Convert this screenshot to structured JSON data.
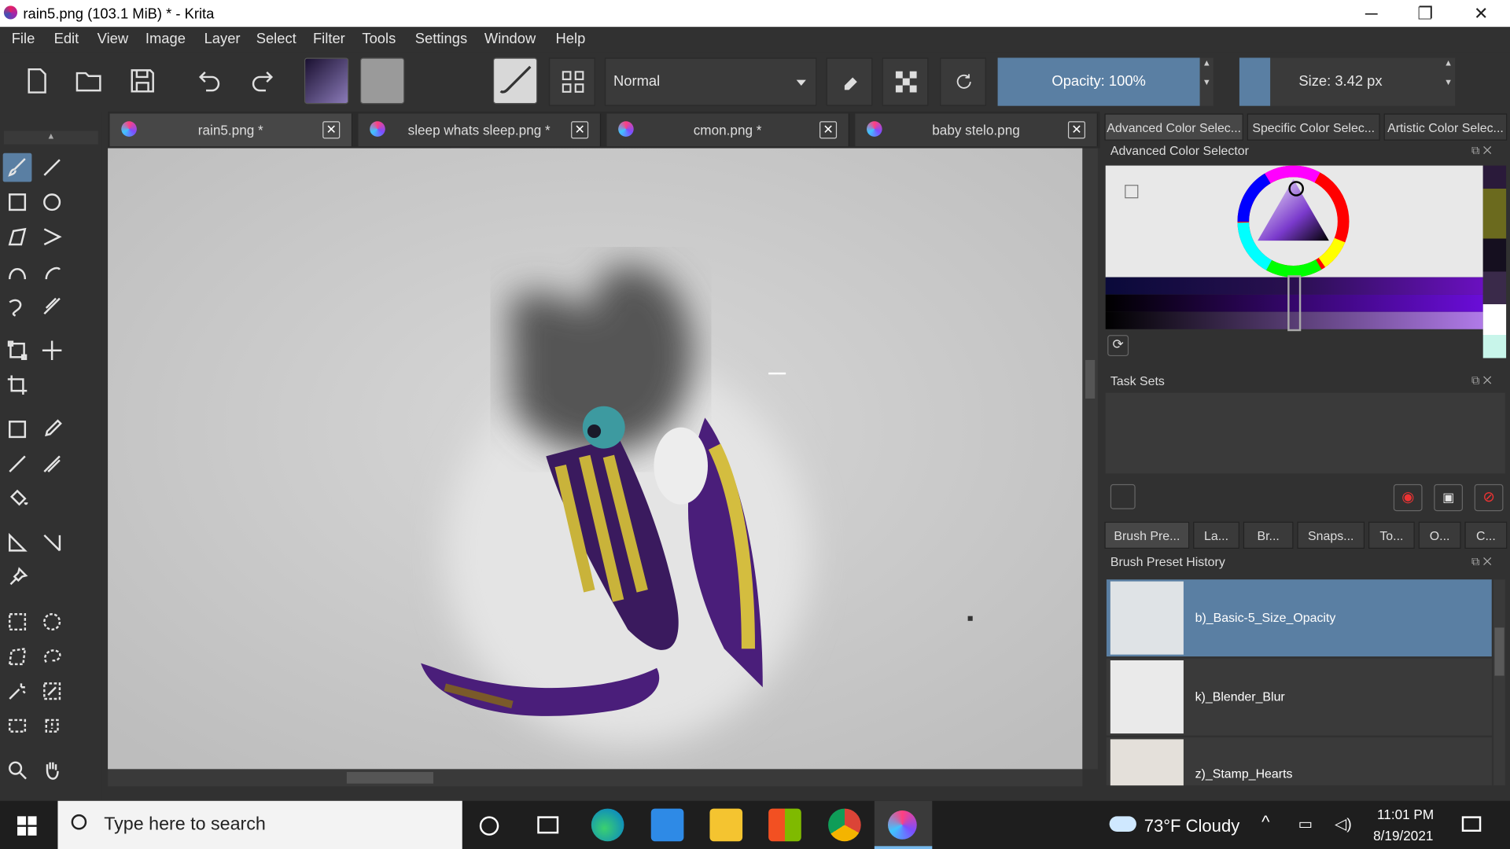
{
  "window": {
    "title": "rain5.png (103.1 MiB)  * - Krita",
    "minimize": "─",
    "maximize": "❐",
    "close": "✕"
  },
  "menu": [
    "File",
    "Edit",
    "View",
    "Image",
    "Layer",
    "Select",
    "Filter",
    "Tools",
    "Settings",
    "Window",
    "Help"
  ],
  "toolbar": {
    "blend_mode": "Normal",
    "opacity_label": "Opacity: 100%",
    "opacity_value": 100,
    "size_label": "Size: 3.42 px",
    "colors": {
      "foreground": "#2a1a3a",
      "background": "#b7a8e8",
      "accent": "#5a7fa3"
    }
  },
  "tabs": [
    {
      "label": "rain5.png *",
      "close": "✕"
    },
    {
      "label": "sleep whats sleep.png *",
      "close": "✕"
    },
    {
      "label": "cmon.png *",
      "close": "✕"
    },
    {
      "label": "baby stelo.png",
      "close": "✕"
    }
  ],
  "docker": {
    "top_tabs": [
      "Advanced Color Selec...",
      "Specific Color Selec...",
      "Artistic Color Selec..."
    ],
    "color_selector_title": "Advanced Color Selector",
    "task_sets_title": "Task Sets",
    "bottom_tabs": [
      "Brush Pre...",
      "La...",
      "Br...",
      "Snaps...",
      "To...",
      "O...",
      "C..."
    ],
    "preset_history_title": "Brush Preset History",
    "presets": [
      "b)_Basic-5_Size_Opacity",
      "k)_Blender_Blur",
      "z)_Stamp_Hearts"
    ]
  },
  "taskbar": {
    "search_placeholder": "Type here to search",
    "weather": "73°F  Cloudy",
    "time": "11:01 PM",
    "date": "8/19/2021"
  }
}
